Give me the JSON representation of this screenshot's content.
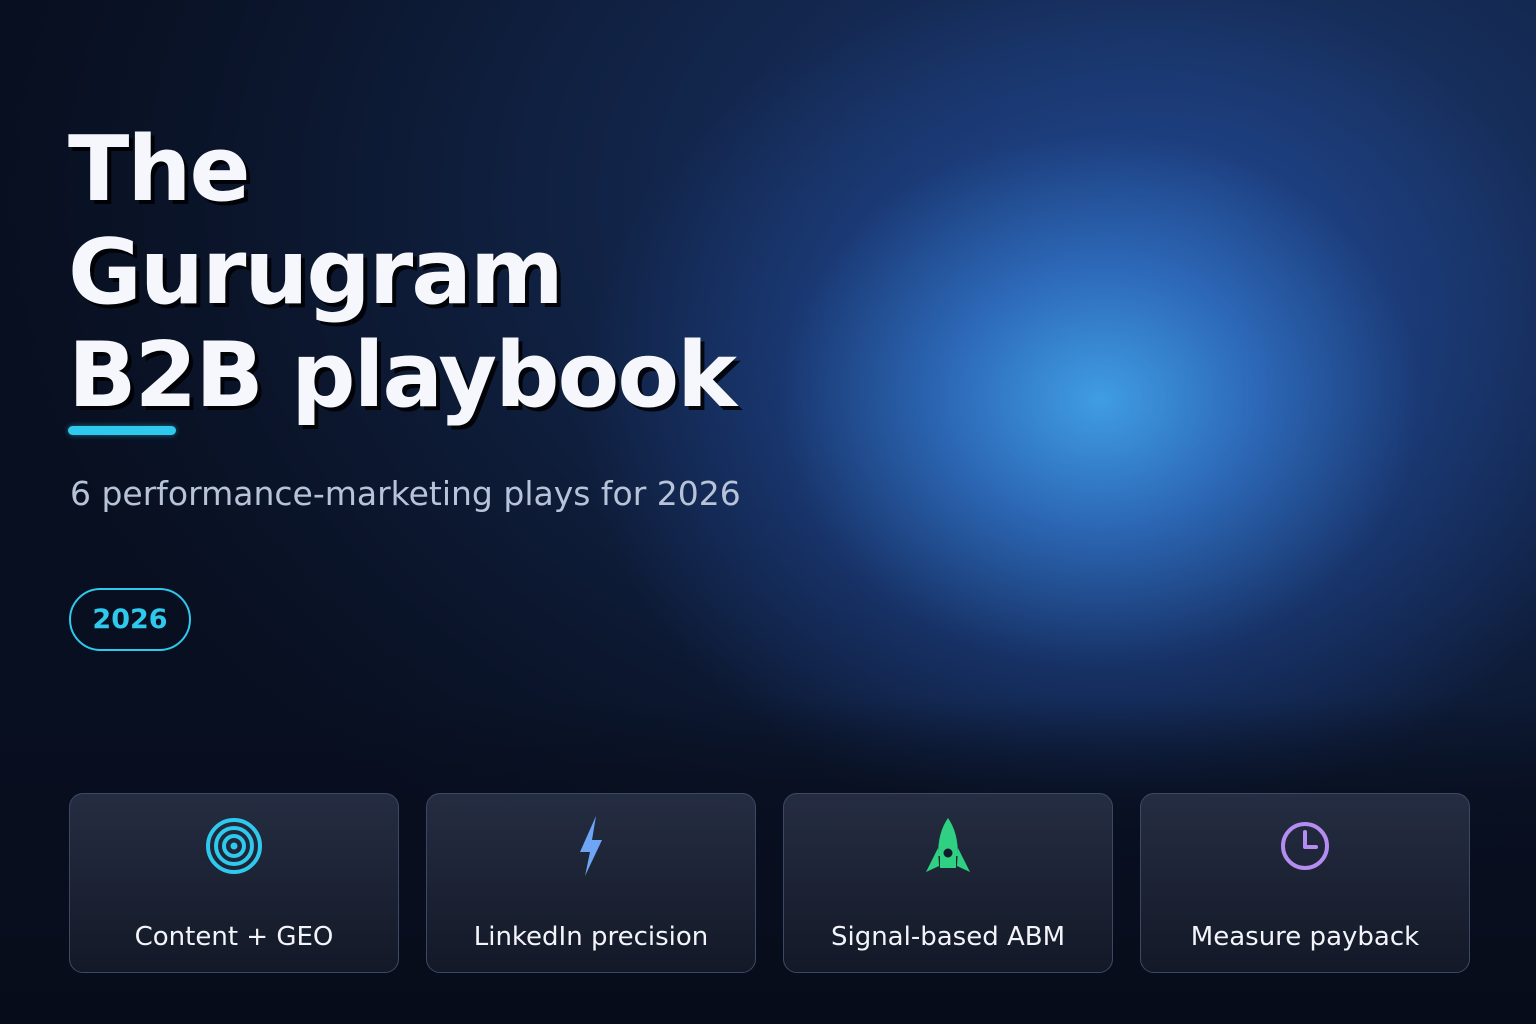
{
  "hero": {
    "title_line1": "The",
    "title_line2": "Gurugram",
    "title_line3_highlight": "B2B",
    "title_line3_rest": " playbook",
    "subtitle": "6 performance-marketing plays for 2026",
    "badge": "2026"
  },
  "cards": [
    {
      "label": "Content + GEO",
      "icon": "target-icon",
      "color": "#2ec9ec"
    },
    {
      "label": "LinkedIn precision",
      "icon": "lightning-icon",
      "color": "#6ea6f5"
    },
    {
      "label": "Signal-based ABM",
      "icon": "rocket-icon",
      "color": "#2fd081"
    },
    {
      "label": "Measure payback",
      "icon": "clock-icon",
      "color": "#b58cf0"
    }
  ],
  "colors": {
    "accent": "#2ec9ec",
    "background": "#0a1224"
  }
}
